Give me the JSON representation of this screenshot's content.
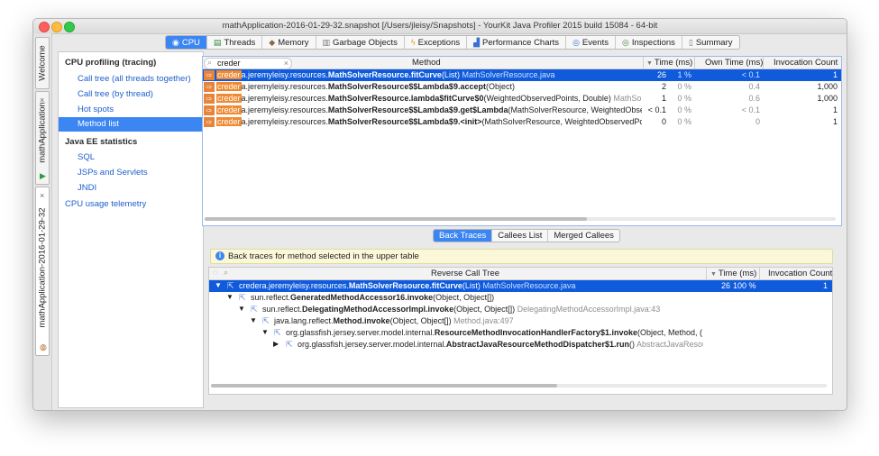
{
  "window": {
    "title": "mathApplication-2016-01-29-32.snapshot [/Users/jleisy/Snapshots] - YourKit Java Profiler 2015 build 15084 - 64-bit"
  },
  "tabs": [
    {
      "label": "CPU",
      "icon": "cpu-icon"
    },
    {
      "label": "Threads",
      "icon": "threads-icon"
    },
    {
      "label": "Memory",
      "icon": "memory-icon"
    },
    {
      "label": "Garbage Objects",
      "icon": "garbage-icon"
    },
    {
      "label": "Exceptions",
      "icon": "lightning-icon"
    },
    {
      "label": "Performance Charts",
      "icon": "chart-icon"
    },
    {
      "label": "Events",
      "icon": "eye-icon"
    },
    {
      "label": "Inspections",
      "icon": "eye-icon"
    },
    {
      "label": "Summary",
      "icon": "document-icon"
    }
  ],
  "side_tabs": {
    "welcome": "Welcome",
    "app": "mathApplication",
    "snapshot": "mathApplication-2016-01-29-32"
  },
  "nav": {
    "cpu_header": "CPU profiling (tracing)",
    "items": [
      "Call tree (all threads together)",
      "Call tree (by thread)",
      "Hot spots",
      "Method list"
    ],
    "javaee_header": "Java EE statistics",
    "javaee_items": [
      "SQL",
      "JSPs and Servlets",
      "JNDI"
    ],
    "telemetry": "CPU usage telemetry"
  },
  "method_table": {
    "search_value": "creder",
    "columns": [
      "Method",
      "Time (ms)",
      "Own Time (ms)",
      "Invocation Count"
    ],
    "rows": [
      {
        "match": "creder",
        "pre": "a.jeremyleisy.resources.",
        "bold": "MathSolverResource.fitCurve",
        "post": "(List)",
        "src": "MathSolverResource.java",
        "time": "26",
        "pct": "1 %",
        "own": "< 0.1",
        "count": "1"
      },
      {
        "match": "creder",
        "pre": "a.jeremyleisy.resources.",
        "bold": "MathSolverResource$$Lambda$9.accept",
        "post": "(Object)",
        "src": "",
        "time": "2",
        "pct": "0 %",
        "own": "0.4",
        "count": "1,000"
      },
      {
        "match": "creder",
        "pre": "a.jeremyleisy.resources.",
        "bold": "MathSolverResource.lambda$fitCurve$0",
        "post": "(WeightedObservedPoints, Double)",
        "src": "MathSo",
        "time": "1",
        "pct": "0 %",
        "own": "0.6",
        "count": "1,000"
      },
      {
        "match": "creder",
        "pre": "a.jeremyleisy.resources.",
        "bold": "MathSolverResource$$Lambda$9.get$Lambda",
        "post": "(MathSolverResource, WeightedObse",
        "src": "",
        "time": "< 0.1",
        "pct": "0 %",
        "own": "< 0.1",
        "count": "1"
      },
      {
        "match": "creder",
        "pre": "a.jeremyleisy.resources.",
        "bold": "MathSolverResource$$Lambda$9.<init>",
        "post": "(MathSolverResource, WeightedObservedPc",
        "src": "",
        "time": "0",
        "pct": "0 %",
        "own": "0",
        "count": "1"
      }
    ]
  },
  "lower": {
    "segments": [
      "Back Traces",
      "Callees List",
      "Merged Callees"
    ],
    "info": "Back traces for method selected in the upper table",
    "columns": [
      "Reverse Call Tree",
      "Time (ms)",
      "Invocation Count"
    ],
    "rows": [
      {
        "pre": "credera.jeremyleisy.resources.",
        "bold": "MathSolverResource.fitCurve",
        "post": "(List)",
        "src": "MathSolverResource.java",
        "time": "26",
        "pct": "100 %",
        "count": "1"
      },
      {
        "pre": "sun.reflect.",
        "bold": "GeneratedMethodAccessor16.invoke",
        "post": "(Object, Object[])",
        "src": ""
      },
      {
        "pre": "sun.reflect.",
        "bold": "DelegatingMethodAccessorImpl.invoke",
        "post": "(Object, Object[])",
        "src": "DelegatingMethodAccessorImpl.java:43"
      },
      {
        "pre": "java.lang.reflect.",
        "bold": "Method.invoke",
        "post": "(Object, Object[])",
        "src": "Method.java:497"
      },
      {
        "pre": "org.glassfish.jersey.server.model.internal.",
        "bold": "ResourceMethodInvocationHandlerFactory$1.invoke",
        "post": "(Object, Method, (",
        "src": ""
      },
      {
        "pre": "org.glassfish.jersey.server.model.internal.",
        "bold": "AbstractJavaResourceMethodDispatcher$1.run",
        "post": "()",
        "src": "AbstractJavaResou"
      }
    ]
  }
}
